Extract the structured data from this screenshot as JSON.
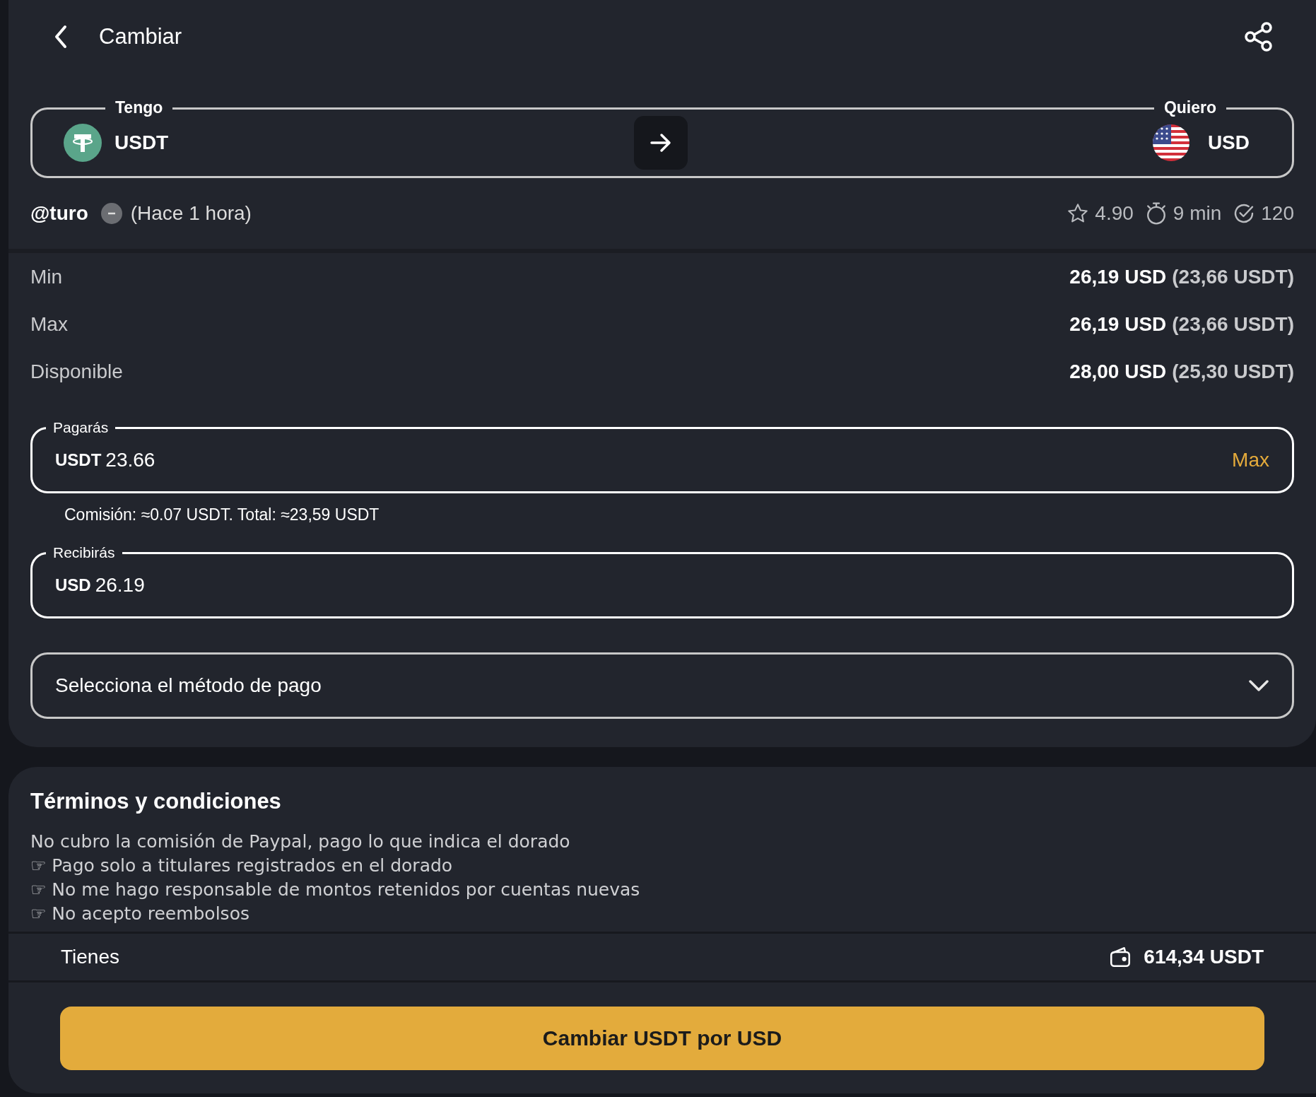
{
  "header": {
    "title": "Cambiar"
  },
  "pair": {
    "have_label": "Tengo",
    "have": "USDT",
    "want_label": "Quiero",
    "want": "USD"
  },
  "seller": {
    "name": "@turo",
    "last_seen": "(Hace 1 hora)",
    "rating": "4.90",
    "time": "9 min",
    "trades": "120"
  },
  "limits": [
    {
      "label": "Min",
      "amount": "26,19 USD",
      "converted": "(23,66 USDT)"
    },
    {
      "label": "Max",
      "amount": "26,19 USD",
      "converted": "(23,66 USDT)"
    },
    {
      "label": "Disponible",
      "amount": "28,00 USD",
      "converted": "(25,30 USDT)"
    }
  ],
  "pay": {
    "label": "Pagarás",
    "currency": "USDT",
    "value": "23.66",
    "max": "Max"
  },
  "fee": "Comisión: ≈0.07 USDT. Total: ≈23,59 USDT",
  "receive": {
    "label": "Recibirás",
    "currency": "USD",
    "value": "26.19"
  },
  "payment_method": {
    "placeholder": "Selecciona el método de pago"
  },
  "terms": {
    "title": "Términos y condiciones",
    "lines": [
      "No cubro la comisión de Paypal, pago lo que indica el dorado",
      "☞ Pago solo a titulares registrados en el dorado",
      "☞ No me hago responsable de montos retenidos por cuentas nuevas",
      "☞ No acepto reembolsos"
    ]
  },
  "balance": {
    "label": "Tienes",
    "amount": "614,34 USDT"
  },
  "submit": "Cambiar USDT por USD"
}
